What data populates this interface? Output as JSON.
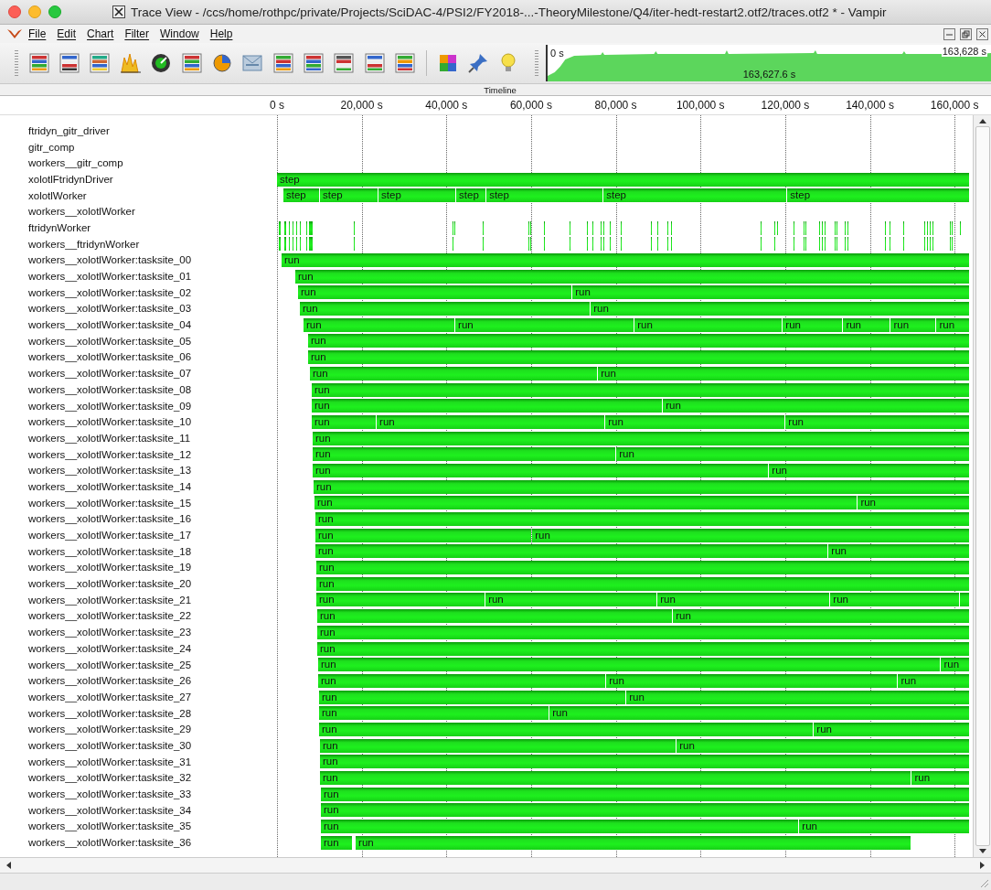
{
  "window": {
    "title": "Trace View - /ccs/home/rothpc/private/Projects/SciDAC-4/PSI2/FY2018-...-TheoryMilestone/Q4/iter-hedt-restart2.otf2/traces.otf2 * - Vampir"
  },
  "menu": [
    "File",
    "Edit",
    "Chart",
    "Filter",
    "Window",
    "Help"
  ],
  "overview": {
    "start_label": "0 s",
    "end_label": "163,628 s",
    "duration_label": "163,627.6 s"
  },
  "timeline": {
    "title": "Timeline",
    "xticks": [
      "0 s",
      "20,000 s",
      "40,000 s",
      "60,000 s",
      "80,000 s",
      "100,000 s",
      "120,000 s",
      "140,000 s",
      "160,000 s"
    ],
    "rows": [
      {
        "name": "ftridyn_gitr_driver"
      },
      {
        "name": "gitr_comp"
      },
      {
        "name": "workers__gitr_comp"
      },
      {
        "name": "xolotlFtridynDriver",
        "segments": [
          {
            "label": "step"
          }
        ]
      },
      {
        "name": "xolotlWorker",
        "segments": [
          {
            "label": "step"
          },
          {
            "label": "step"
          },
          {
            "label": "step"
          },
          {
            "label": "step"
          },
          {
            "label": "step"
          },
          {
            "label": "step"
          },
          {
            "label": "step"
          }
        ]
      },
      {
        "name": "workers__xolotlWorker"
      },
      {
        "name": "ftridynWorker"
      },
      {
        "name": "workers__ftridynWorker"
      },
      {
        "name": "workers__xolotlWorker:tasksite_00",
        "segments": [
          {
            "label": "run"
          }
        ]
      },
      {
        "name": "workers__xolotlWorker:tasksite_01",
        "segments": [
          {
            "label": "run"
          }
        ]
      },
      {
        "name": "workers__xolotlWorker:tasksite_02",
        "segments": [
          {
            "label": "run"
          },
          {
            "label": "run"
          }
        ]
      },
      {
        "name": "workers__xolotlWorker:tasksite_03",
        "segments": [
          {
            "label": "run"
          },
          {
            "label": "run"
          }
        ]
      },
      {
        "name": "workers__xolotlWorker:tasksite_04",
        "segments": [
          {
            "label": "run"
          },
          {
            "label": "run"
          },
          {
            "label": "run"
          },
          {
            "label": "run"
          },
          {
            "label": "run"
          },
          {
            "label": "run"
          },
          {
            "label": "run"
          }
        ]
      },
      {
        "name": "workers__xolotlWorker:tasksite_05",
        "segments": [
          {
            "label": "run"
          }
        ]
      },
      {
        "name": "workers__xolotlWorker:tasksite_06",
        "segments": [
          {
            "label": "run"
          }
        ]
      },
      {
        "name": "workers__xolotlWorker:tasksite_07",
        "segments": [
          {
            "label": "run"
          },
          {
            "label": "run"
          }
        ]
      },
      {
        "name": "workers__xolotlWorker:tasksite_08",
        "segments": [
          {
            "label": "run"
          }
        ]
      },
      {
        "name": "workers__xolotlWorker:tasksite_09",
        "segments": [
          {
            "label": "run"
          },
          {
            "label": "run"
          }
        ]
      },
      {
        "name": "workers__xolotlWorker:tasksite_10",
        "segments": [
          {
            "label": "run"
          },
          {
            "label": "run"
          },
          {
            "label": "run"
          },
          {
            "label": "run"
          }
        ]
      },
      {
        "name": "workers__xolotlWorker:tasksite_11",
        "segments": [
          {
            "label": "run"
          }
        ]
      },
      {
        "name": "workers__xolotlWorker:tasksite_12",
        "segments": [
          {
            "label": "run"
          },
          {
            "label": "run"
          }
        ]
      },
      {
        "name": "workers__xolotlWorker:tasksite_13",
        "segments": [
          {
            "label": "run"
          },
          {
            "label": "run"
          }
        ]
      },
      {
        "name": "workers__xolotlWorker:tasksite_14",
        "segments": [
          {
            "label": "run"
          }
        ]
      },
      {
        "name": "workers__xolotlWorker:tasksite_15",
        "segments": [
          {
            "label": "run"
          },
          {
            "label": "run"
          }
        ]
      },
      {
        "name": "workers__xolotlWorker:tasksite_16",
        "segments": [
          {
            "label": "run"
          }
        ]
      },
      {
        "name": "workers__xolotlWorker:tasksite_17",
        "segments": [
          {
            "label": "run"
          },
          {
            "label": "run"
          }
        ]
      },
      {
        "name": "workers__xolotlWorker:tasksite_18",
        "segments": [
          {
            "label": "run"
          },
          {
            "label": "run"
          }
        ]
      },
      {
        "name": "workers__xolotlWorker:tasksite_19",
        "segments": [
          {
            "label": "run"
          }
        ]
      },
      {
        "name": "workers__xolotlWorker:tasksite_20",
        "segments": [
          {
            "label": "run"
          }
        ]
      },
      {
        "name": "workers__xolotlWorker:tasksite_21",
        "segments": [
          {
            "label": "run"
          },
          {
            "label": "run"
          },
          {
            "label": "run"
          },
          {
            "label": "run"
          }
        ]
      },
      {
        "name": "workers__xolotlWorker:tasksite_22",
        "segments": [
          {
            "label": "run"
          },
          {
            "label": "run"
          }
        ]
      },
      {
        "name": "workers__xolotlWorker:tasksite_23",
        "segments": [
          {
            "label": "run"
          }
        ]
      },
      {
        "name": "workers__xolotlWorker:tasksite_24",
        "segments": [
          {
            "label": "run"
          }
        ]
      },
      {
        "name": "workers__xolotlWorker:tasksite_25",
        "segments": [
          {
            "label": "run"
          },
          {
            "label": "run"
          }
        ]
      },
      {
        "name": "workers__xolotlWorker:tasksite_26",
        "segments": [
          {
            "label": "run"
          },
          {
            "label": "run"
          },
          {
            "label": "run"
          }
        ]
      },
      {
        "name": "workers__xolotlWorker:tasksite_27",
        "segments": [
          {
            "label": "run"
          },
          {
            "label": "run"
          }
        ]
      },
      {
        "name": "workers__xolotlWorker:tasksite_28",
        "segments": [
          {
            "label": "run"
          },
          {
            "label": "run"
          }
        ]
      },
      {
        "name": "workers__xolotlWorker:tasksite_29",
        "segments": [
          {
            "label": "run"
          },
          {
            "label": "run"
          }
        ]
      },
      {
        "name": "workers__xolotlWorker:tasksite_30",
        "segments": [
          {
            "label": "run"
          },
          {
            "label": "run"
          }
        ]
      },
      {
        "name": "workers__xolotlWorker:tasksite_31",
        "segments": [
          {
            "label": "run"
          }
        ]
      },
      {
        "name": "workers__xolotlWorker:tasksite_32",
        "segments": [
          {
            "label": "run"
          },
          {
            "label": "run"
          }
        ]
      },
      {
        "name": "workers__xolotlWorker:tasksite_33",
        "segments": [
          {
            "label": "run"
          }
        ]
      },
      {
        "name": "workers__xolotlWorker:tasksite_34",
        "segments": [
          {
            "label": "run"
          }
        ]
      },
      {
        "name": "workers__xolotlWorker:tasksite_35",
        "segments": [
          {
            "label": "run"
          },
          {
            "label": "run"
          }
        ]
      },
      {
        "name": "workers__xolotlWorker:tasksite_36",
        "segments": [
          {
            "label": "run"
          },
          {
            "label": "run"
          }
        ]
      }
    ]
  }
}
